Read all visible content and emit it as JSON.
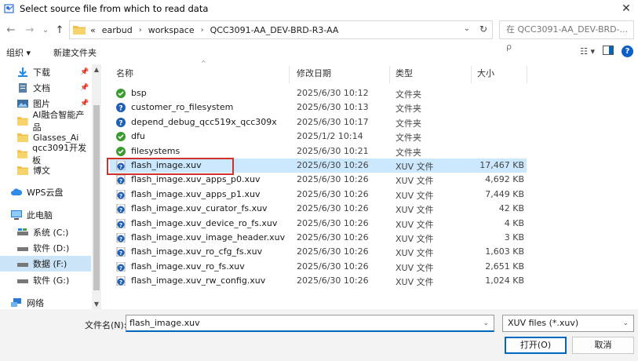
{
  "window": {
    "title": "Select source file from which to read data",
    "close": "✕"
  },
  "nav": {
    "back": "←",
    "forward": "→",
    "dropdown": "⌄",
    "up": "↑"
  },
  "address": {
    "overflow": "«",
    "crumbs": [
      "earbud",
      "workspace",
      "QCC3091-AA_DEV-BRD-R3-AA"
    ],
    "separator": "›"
  },
  "search": {
    "placeholder": "在 QCC3091-AA_DEV-BRD-... ρ"
  },
  "toolbar": {
    "organize": "组织 ▾",
    "new_folder": "新建文件夹"
  },
  "sidebar": {
    "items": [
      {
        "label": "下载",
        "icon": "download-icon",
        "pinned": true
      },
      {
        "label": "文档",
        "icon": "document-icon",
        "pinned": true
      },
      {
        "label": "图片",
        "icon": "picture-icon",
        "pinned": true
      },
      {
        "label": "AI融合智能产品",
        "icon": "folder-icon"
      },
      {
        "label": "Glasses_Ai",
        "icon": "folder-icon"
      },
      {
        "label": "qcc3091开发板",
        "icon": "folder-icon"
      },
      {
        "label": "博文",
        "icon": "folder-icon"
      },
      {
        "label": "WPS云盘",
        "icon": "cloud-icon"
      },
      {
        "label": "此电脑",
        "icon": "computer-icon"
      },
      {
        "label": "系统 (C:)",
        "icon": "drive-icon"
      },
      {
        "label": "软件 (D:)",
        "icon": "drive-icon"
      },
      {
        "label": "数据 (F:)",
        "icon": "drive-icon",
        "selected": true
      },
      {
        "label": "软件 (G:)",
        "icon": "drive-icon"
      },
      {
        "label": "网络",
        "icon": "network-icon"
      }
    ]
  },
  "columns": {
    "name": "名称",
    "date": "修改日期",
    "type": "类型",
    "size": "大小"
  },
  "files": [
    {
      "name": "bsp",
      "date": "2025/6/30 10:12",
      "type": "文件夹",
      "size": "",
      "icon": "green-check"
    },
    {
      "name": "customer_ro_filesystem",
      "date": "2025/6/30 10:13",
      "type": "文件夹",
      "size": "",
      "icon": "blue-question"
    },
    {
      "name": "depend_debug_qcc519x_qcc309x",
      "date": "2025/6/30 10:17",
      "type": "文件夹",
      "size": "",
      "icon": "blue-question"
    },
    {
      "name": "dfu",
      "date": "2025/1/2 10:14",
      "type": "文件夹",
      "size": "",
      "icon": "green-check"
    },
    {
      "name": "filesystems",
      "date": "2025/6/30 10:21",
      "type": "文件夹",
      "size": "",
      "icon": "green-check"
    },
    {
      "name": "flash_image.xuv",
      "date": "2025/6/30 10:26",
      "type": "XUV 文件",
      "size": "17,467 KB",
      "icon": "file-question",
      "selected": true
    },
    {
      "name": "flash_image.xuv_apps_p0.xuv",
      "date": "2025/6/30 10:26",
      "type": "XUV 文件",
      "size": "4,692 KB",
      "icon": "file-question"
    },
    {
      "name": "flash_image.xuv_apps_p1.xuv",
      "date": "2025/6/30 10:26",
      "type": "XUV 文件",
      "size": "7,449 KB",
      "icon": "file-question"
    },
    {
      "name": "flash_image.xuv_curator_fs.xuv",
      "date": "2025/6/30 10:26",
      "type": "XUV 文件",
      "size": "42 KB",
      "icon": "file-question"
    },
    {
      "name": "flash_image.xuv_device_ro_fs.xuv",
      "date": "2025/6/30 10:26",
      "type": "XUV 文件",
      "size": "4 KB",
      "icon": "file-question"
    },
    {
      "name": "flash_image.xuv_image_header.xuv",
      "date": "2025/6/30 10:26",
      "type": "XUV 文件",
      "size": "3 KB",
      "icon": "file-question"
    },
    {
      "name": "flash_image.xuv_ro_cfg_fs.xuv",
      "date": "2025/6/30 10:26",
      "type": "XUV 文件",
      "size": "1,603 KB",
      "icon": "file-question"
    },
    {
      "name": "flash_image.xuv_ro_fs.xuv",
      "date": "2025/6/30 10:26",
      "type": "XUV 文件",
      "size": "2,651 KB",
      "icon": "file-question"
    },
    {
      "name": "flash_image.xuv_rw_config.xuv",
      "date": "2025/6/30 10:26",
      "type": "XUV 文件",
      "size": "1,024 KB",
      "icon": "file-question"
    }
  ],
  "footer": {
    "filename_label": "文件名(N):",
    "filename_value": "flash_image.xuv",
    "filter_value": "XUV files (*.xuv)",
    "open": "打开(O)",
    "cancel": "取消"
  },
  "colors": {
    "accent": "#0067c0",
    "selection": "#cce8ff",
    "highlight_box": "#d0312d"
  }
}
